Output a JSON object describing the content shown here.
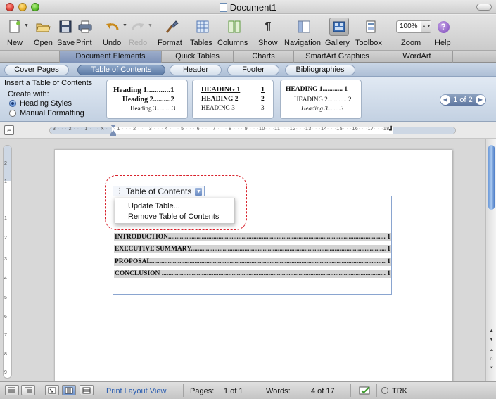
{
  "window": {
    "title": "Document1"
  },
  "toolbar": {
    "items": [
      {
        "label": "New",
        "icon": "new-document-icon"
      },
      {
        "label": "Open",
        "icon": "open-folder-icon"
      },
      {
        "label": "Save",
        "icon": "save-disk-icon"
      },
      {
        "label": "Print",
        "icon": "printer-icon"
      },
      {
        "label": "Undo",
        "icon": "undo-arrow-icon"
      },
      {
        "label": "Redo",
        "icon": "redo-arrow-icon"
      },
      {
        "label": "Format",
        "icon": "format-brush-icon"
      },
      {
        "label": "Tables",
        "icon": "table-grid-icon"
      },
      {
        "label": "Columns",
        "icon": "columns-icon"
      },
      {
        "label": "Show",
        "icon": "pilcrow-icon"
      },
      {
        "label": "Navigation",
        "icon": "navigation-pane-icon"
      },
      {
        "label": "Gallery",
        "icon": "gallery-icon"
      },
      {
        "label": "Toolbox",
        "icon": "toolbox-icon"
      },
      {
        "label": "Zoom",
        "icon": "zoom-select-icon"
      },
      {
        "label": "Help",
        "icon": "help-icon"
      }
    ],
    "zoom_value": "100%",
    "pilcrow": "¶",
    "help_glyph": "?"
  },
  "ribbon_tabs": [
    "Document Elements",
    "Quick Tables",
    "Charts",
    "SmartArt Graphics",
    "WordArt"
  ],
  "gallery_tabs": [
    "Cover Pages",
    "Table of Contents",
    "Header",
    "Footer",
    "Bibliographies"
  ],
  "toc_pane": {
    "title": "Insert a Table of Contents",
    "create_with": "Create with:",
    "options": [
      "Heading Styles",
      "Manual Formatting"
    ],
    "thumbnails": [
      {
        "h1": "Heading 1............1",
        "h2": "Heading 2..........2",
        "h3": "Heading 3..........3"
      },
      {
        "h1": "HEADING 1",
        "p1": "1",
        "h2": "HEADING 2",
        "p2": "2",
        "h3": "HEADING 3",
        "p3": "3"
      },
      {
        "h1": "HEADING 1............ 1",
        "h2": "HEADING 2............ 2",
        "h3": "Heading 3........3"
      }
    ],
    "pager": "1 of 2"
  },
  "ruler": {
    "ticks": "3 · · · 2 · · · 1 · · · X · · · 1 · · · 2 · · · 3 · · · 4 · · · 5 · · · 6 · · · 7 · · · 8 · · · 9 · · ·10· · ·11· · ·12· · ·13· · ·14· · ·15· · ·16· · ·17· · ·18",
    "vertical_ticks": [
      "2",
      "1",
      "1",
      "2",
      "3",
      "4",
      "5",
      "6",
      "7",
      "8",
      "9"
    ]
  },
  "document": {
    "toc_tag": "Table of Contents",
    "context_menu": [
      "Update Table...",
      "Remove Table of Contents"
    ],
    "entries": [
      {
        "text": "INTRODUCTION..........................................................................................................................................",
        "page": "1"
      },
      {
        "text": "EXECUTIVE SUMMARY..............................................................................................................................",
        "page": "1"
      },
      {
        "text": "PROPOSAL.................................................................................................................................................",
        "page": "1"
      },
      {
        "text": "CONCLUSION ............................................................................................................................................",
        "page": "1"
      }
    ]
  },
  "status": {
    "view": "Print Layout View",
    "pages_label": "Pages:",
    "pages_value": "1 of 1",
    "words_label": "Words:",
    "words_value": "4 of 17",
    "trk": "TRK"
  },
  "colors": {
    "accent_blue": "#6f93cc",
    "callout_red": "#d8202a",
    "toc_entry_bg": "#d3d3d3"
  }
}
